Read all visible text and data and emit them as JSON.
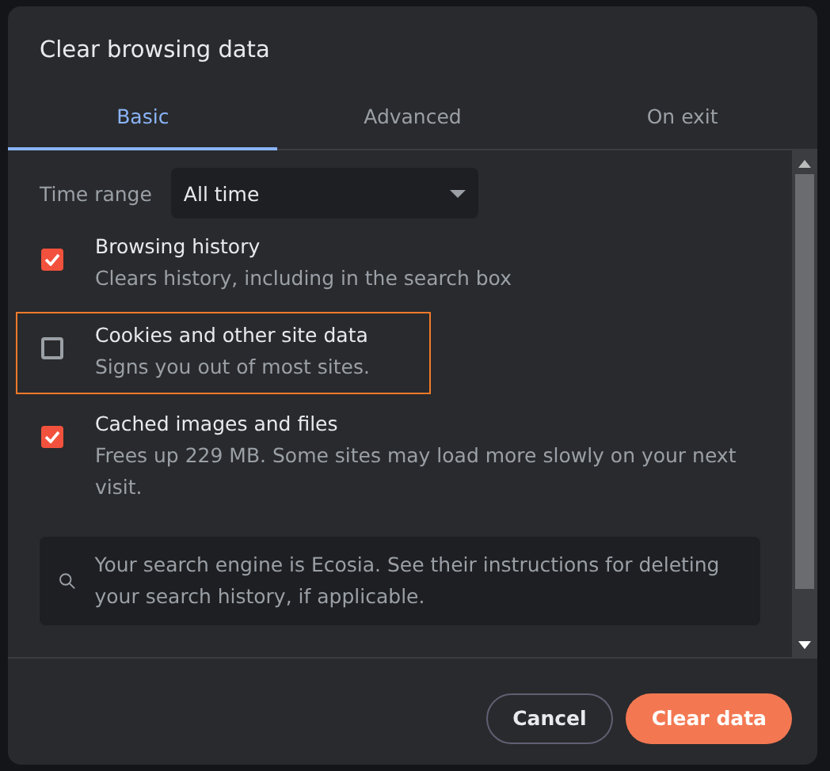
{
  "dialog": {
    "title": "Clear browsing data"
  },
  "tabs": [
    {
      "label": "Basic",
      "selected": true
    },
    {
      "label": "Advanced",
      "selected": false
    },
    {
      "label": "On exit",
      "selected": false
    }
  ],
  "time_range": {
    "label": "Time range",
    "value": "All time"
  },
  "items": [
    {
      "title": "Browsing history",
      "description": "Clears history, including in the search box",
      "checked": true,
      "focused": false
    },
    {
      "title": "Cookies and other site data",
      "description": "Signs you out of most sites.",
      "checked": false,
      "focused": true
    },
    {
      "title": "Cached images and files",
      "description": "Frees up 229 MB. Some sites may load more slowly on your next visit.",
      "checked": true,
      "focused": false
    }
  ],
  "notice": "Your search engine is Ecosia. See their instructions for deleting your search history, if applicable.",
  "buttons": [
    {
      "label": "Cancel",
      "kind": "secondary"
    },
    {
      "label": "Clear data",
      "kind": "primary"
    }
  ]
}
